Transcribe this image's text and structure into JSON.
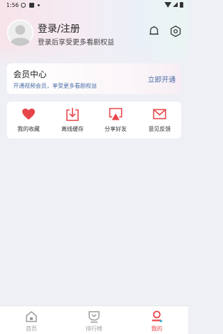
{
  "status_bar": {
    "time": "1:56"
  },
  "profile": {
    "title": "登录/注册",
    "subtitle": "登录后享受更多看剧权益"
  },
  "vip": {
    "title": "会员中心",
    "subtitle": "开通视频会员，享受更多看剧权益",
    "action": "立即开通"
  },
  "actions": [
    {
      "label": "我的收藏",
      "icon": "heart-icon"
    },
    {
      "label": "离线缓存",
      "icon": "download-icon"
    },
    {
      "label": "分享好友",
      "icon": "share-icon"
    },
    {
      "label": "意见反馈",
      "icon": "mail-icon"
    }
  ],
  "bottom_nav": [
    {
      "label": "首页",
      "icon": "home-icon",
      "active": false
    },
    {
      "label": "排行榜",
      "icon": "ranking-icon",
      "active": false
    },
    {
      "label": "我的",
      "icon": "profile-icon",
      "active": true
    }
  ],
  "colors": {
    "accent": "#e8454a",
    "link": "#4c6ca8",
    "background": "#eef0f5"
  }
}
